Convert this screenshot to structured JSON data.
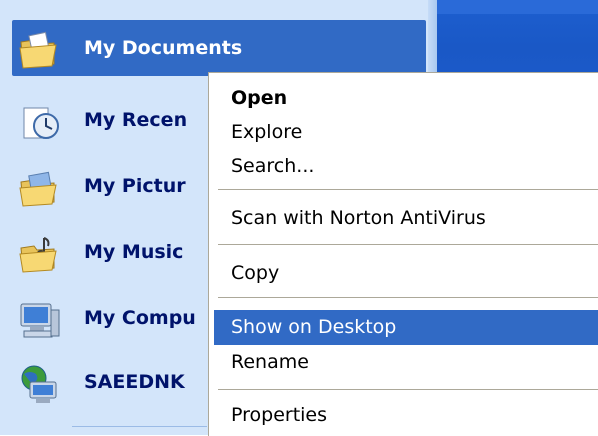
{
  "start_menu": {
    "items": [
      {
        "label": "My Documents",
        "icon": "folder-documents-icon",
        "highlighted": true
      },
      {
        "label": "My Recen",
        "icon": "recent-documents-icon"
      },
      {
        "label": "My Pictur",
        "icon": "folder-pictures-icon"
      },
      {
        "label": "My Music",
        "icon": "folder-music-icon"
      },
      {
        "label": "My Compu",
        "icon": "computer-icon"
      },
      {
        "label": "SAEEDNK",
        "icon": "network-computer-icon"
      }
    ]
  },
  "context_menu": {
    "open": "Open",
    "explore": "Explore",
    "search": "Search...",
    "scan": "Scan with Norton AntiVirus",
    "copy": "Copy",
    "show_on_desktop": "Show on Desktop",
    "rename": "Rename",
    "properties": "Properties",
    "highlighted_item": "Show on Desktop"
  },
  "colors": {
    "pane_background": "#d3e5fa",
    "selection": "#316ac5",
    "label_text": "#00136b",
    "title_blue": "#1d5fd0"
  }
}
